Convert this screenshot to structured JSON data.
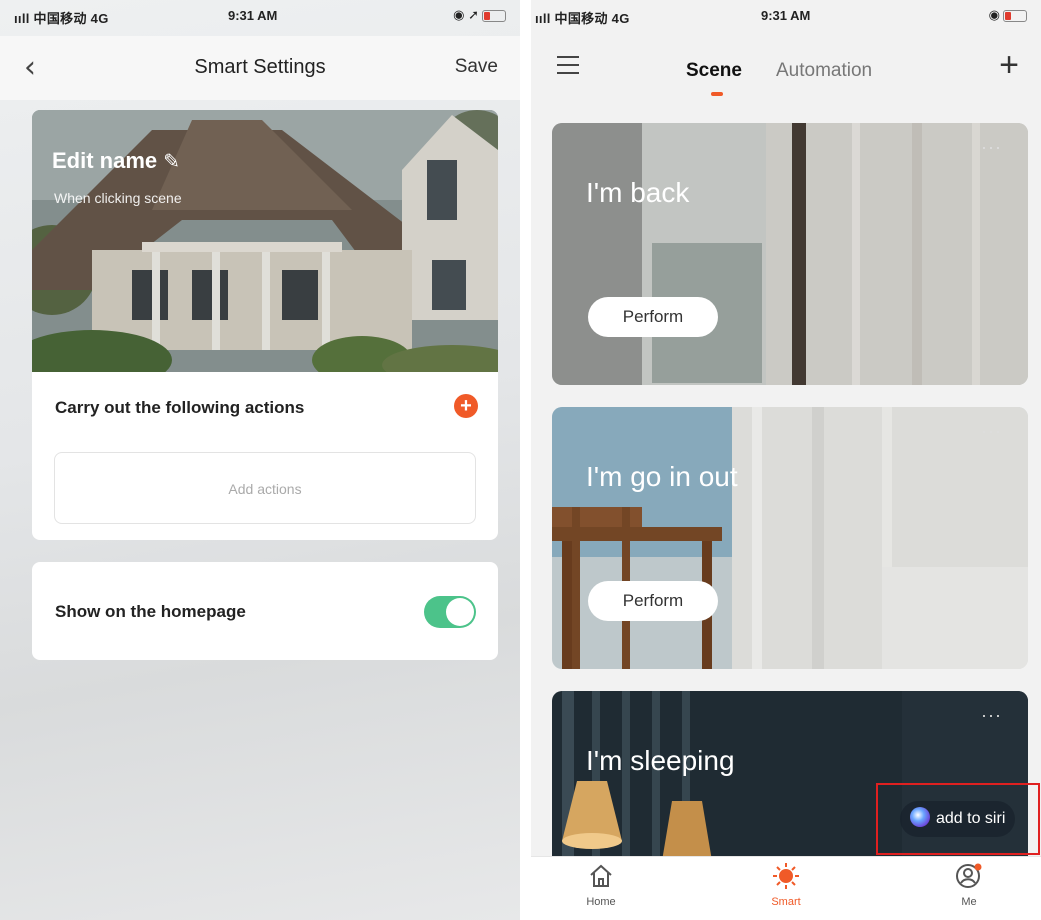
{
  "left_phone": {
    "status": {
      "carrier": "ııll 中国移动  4G",
      "time": "9:31 AM",
      "icons": "◉ ➚"
    },
    "nav": {
      "back_icon": "chevron-left-icon",
      "title": "Smart Settings",
      "save": "Save"
    },
    "hero": {
      "title": "Edit name",
      "edit_icon": "pencil-icon",
      "subtitle": "When clicking  scene"
    },
    "actions": {
      "label": "Carry out the following actions",
      "add_icon": "plus-circle-icon",
      "add_actions": "Add actions"
    },
    "homepage": {
      "label": "Show on the homepage",
      "toggle_on": true
    }
  },
  "right_phone": {
    "status": {
      "carrier": "ııll 中国移动  4G",
      "time": "9:31 AM",
      "icons": "◉"
    },
    "nav": {
      "menu_icon": "hamburger-menu-icon",
      "tabs": [
        "Scene",
        "Automation"
      ],
      "active_tab": "Scene",
      "add_icon": "plus-icon"
    },
    "scenes": [
      {
        "title": "I'm back",
        "button": "Perform",
        "more": "···"
      },
      {
        "title": "I'm go in out",
        "button": "Perform",
        "more": "···"
      },
      {
        "title": "I'm sleeping",
        "more": "···"
      }
    ],
    "siri": {
      "label": "add to siri",
      "highlight_color": "#e02020"
    },
    "tabbar": [
      {
        "label": "Home",
        "icon": "home-icon"
      },
      {
        "label": "Smart",
        "icon": "sun-icon",
        "active": true
      },
      {
        "label": "Me",
        "icon": "user-icon"
      }
    ]
  },
  "colors": {
    "accent": "#f05a28",
    "toggle": "#4cc38a"
  }
}
